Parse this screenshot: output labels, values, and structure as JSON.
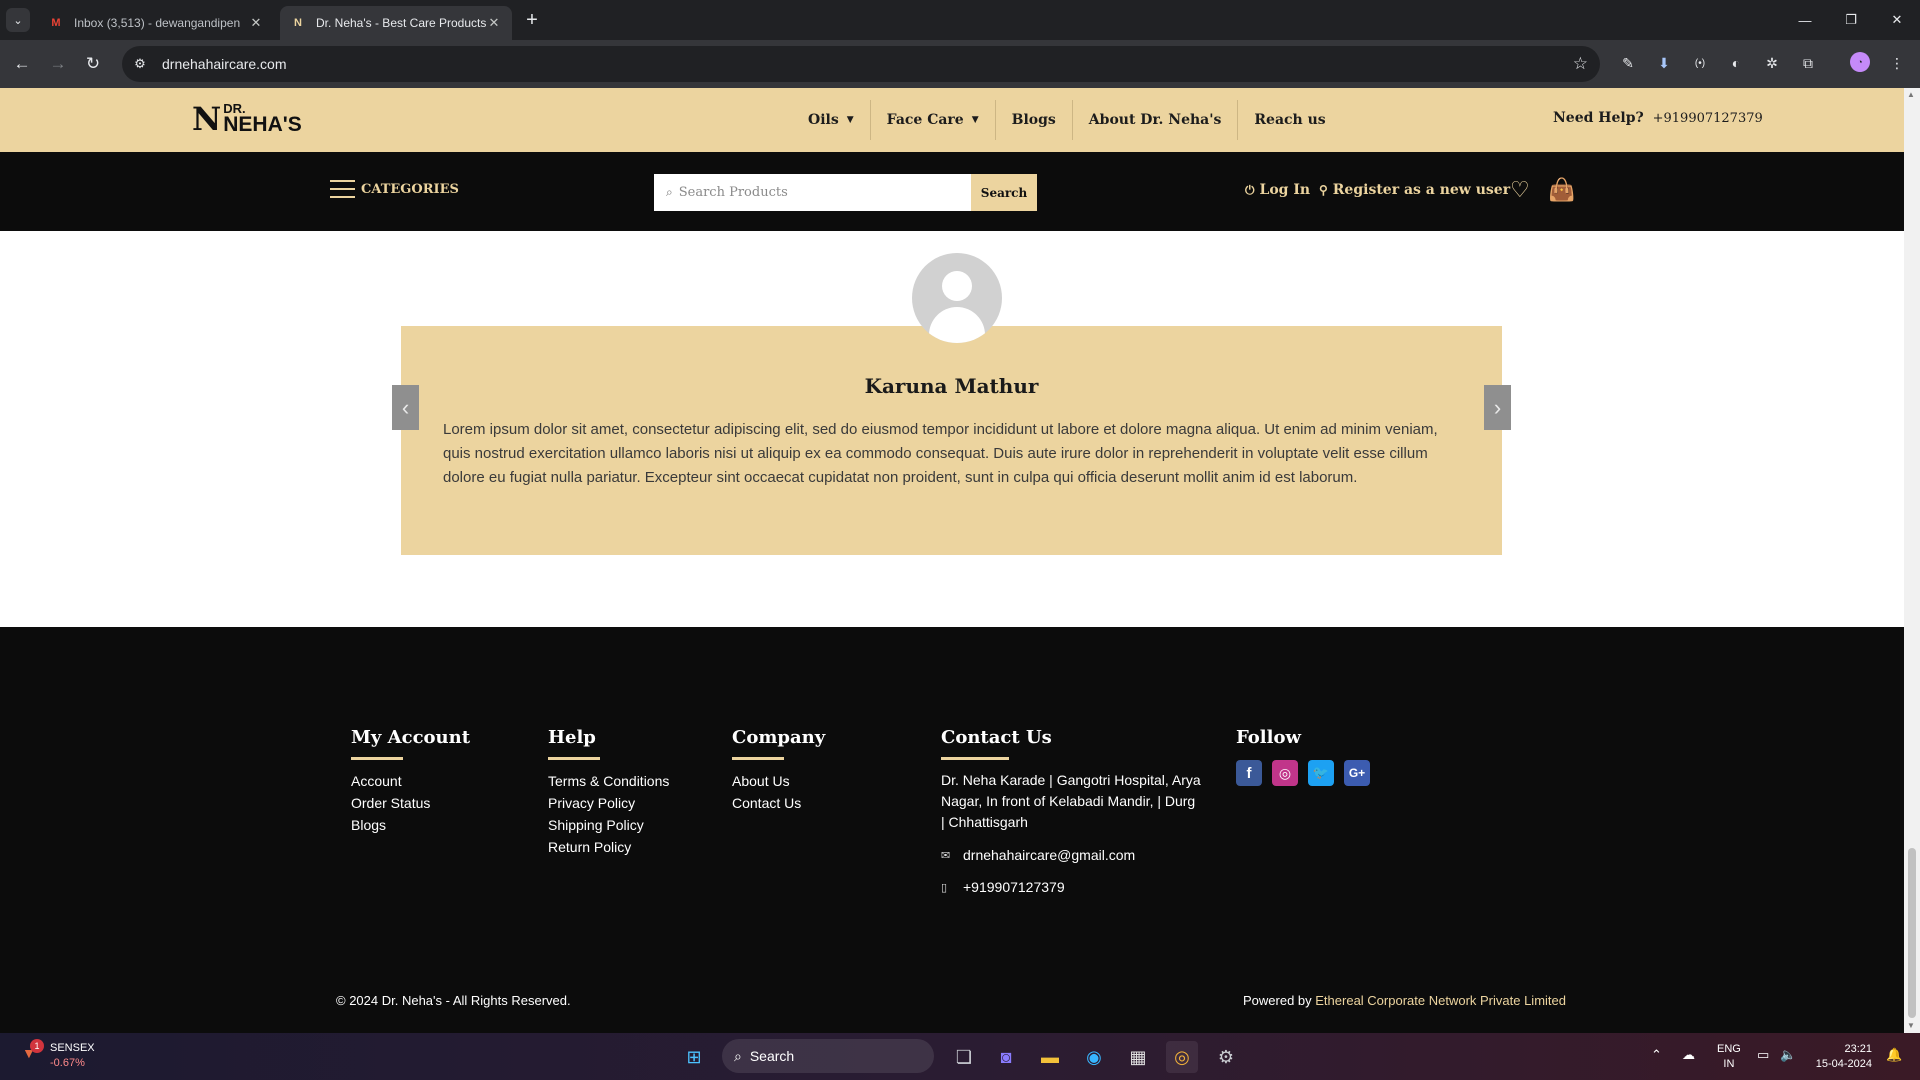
{
  "browser": {
    "tabs": [
      {
        "title": "Inbox (3,513) - dewangandipen",
        "favicon": "gmail-icon"
      },
      {
        "title": "Dr. Neha's - Best Care Products",
        "favicon": "site-icon"
      }
    ],
    "url": "drnehahaircare.com"
  },
  "site": {
    "logo": {
      "mark": "N",
      "line1": "DR.",
      "line2": "NEHA'S"
    },
    "nav": [
      {
        "label": "Oils",
        "has_dropdown": true
      },
      {
        "label": "Face Care",
        "has_dropdown": true
      },
      {
        "label": "Blogs",
        "has_dropdown": false
      },
      {
        "label": "About Dr. Neha's",
        "has_dropdown": false
      },
      {
        "label": "Reach us",
        "has_dropdown": false
      }
    ],
    "help_label": "Need Help?",
    "help_phone": "+919907127379",
    "categories_label": "CATEGORIES",
    "search_placeholder": "Search Products",
    "search_button": "Search",
    "login_label": "Log In",
    "register_label": "Register as a new user",
    "accent_color": "#ecd49f"
  },
  "testimonial": {
    "name": "Karuna Mathur",
    "text": "Lorem ipsum dolor sit amet, consectetur adipiscing elit, sed do eiusmod tempor incididunt ut labore et dolore magna aliqua. Ut enim ad minim veniam, quis nostrud exercitation ullamco laboris nisi ut aliquip ex ea commodo consequat. Duis aute irure dolor in reprehenderit in voluptate velit esse cillum dolore eu fugiat nulla pariatur. Excepteur sint occaecat cupidatat non proident, sunt in culpa qui officia deserunt mollit anim id est laborum."
  },
  "footer": {
    "my_account": {
      "title": "My Account",
      "links": [
        "Account",
        "Order Status",
        "Blogs"
      ]
    },
    "help": {
      "title": "Help",
      "links": [
        "Terms & Conditions",
        "Privacy Policy",
        "Shipping Policy",
        "Return Policy"
      ]
    },
    "company": {
      "title": "Company",
      "links": [
        "About Us",
        "Contact Us"
      ]
    },
    "contact": {
      "title": "Contact Us",
      "address": "Dr. Neha Karade | Gangotri Hospital, Arya Nagar, In front of Kelabadi Mandir, | Durg | Chhattisgarh",
      "email": "drnehahaircare@gmail.com",
      "phone": "+919907127379"
    },
    "follow": {
      "title": "Follow",
      "icons": [
        "facebook-icon",
        "instagram-icon",
        "twitter-icon",
        "google-plus-icon"
      ]
    },
    "copyright": "© 2024 Dr. Neha's - All Rights Reserved.",
    "powered_by": "Powered by",
    "company_name": "Ethereal Corporate Network Private Limited"
  },
  "taskbar": {
    "stock_name": "SENSEX",
    "stock_change": "-0.67%",
    "stock_badge": "1",
    "search_label": "Search",
    "lang_1": "ENG",
    "lang_2": "IN",
    "time": "23:21",
    "date": "15-04-2024"
  }
}
